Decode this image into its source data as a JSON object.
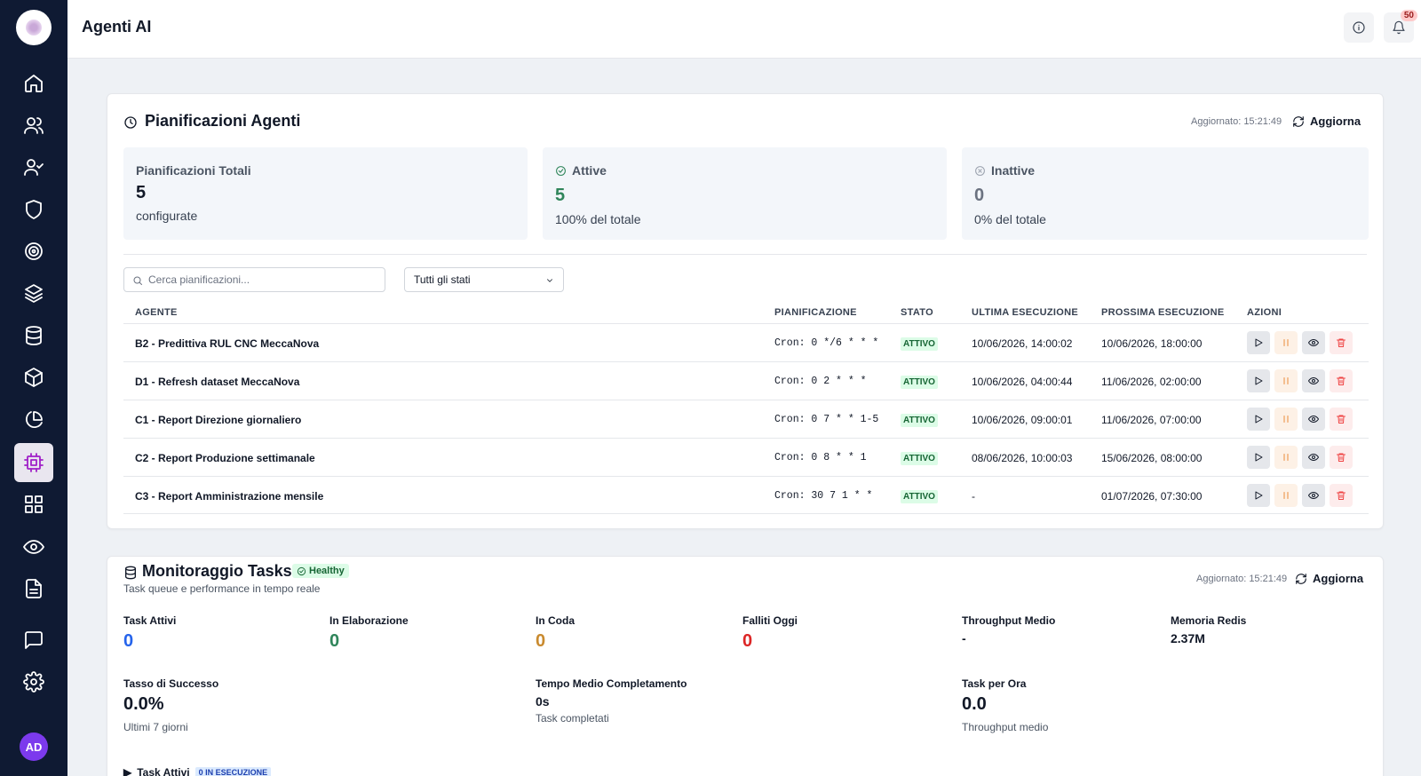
{
  "header": {
    "title": "Agenti AI",
    "notifications_count": "50"
  },
  "sidebar": {
    "avatar_initials": "AD",
    "items": [
      {
        "icon": "home-icon"
      },
      {
        "icon": "users-icon"
      },
      {
        "icon": "user-check-icon"
      },
      {
        "icon": "shield-icon"
      },
      {
        "icon": "target-icon"
      },
      {
        "icon": "layers-icon"
      },
      {
        "icon": "database-icon"
      },
      {
        "icon": "box-icon"
      },
      {
        "icon": "pie-chart-icon"
      },
      {
        "icon": "cpu-icon",
        "active": true
      },
      {
        "icon": "grid-icon"
      },
      {
        "icon": "eye-icon"
      },
      {
        "icon": "file-text-icon"
      },
      {
        "icon": "message-icon"
      },
      {
        "icon": "settings-icon"
      }
    ]
  },
  "schedules": {
    "title": "Pianificazioni Agenti",
    "updated": "Aggiornato: 15:21:49",
    "refresh_label": "Aggiorna",
    "stats": {
      "total": {
        "label": "Pianificazioni Totali",
        "value": "5",
        "sub": "configurate"
      },
      "active": {
        "label": "Attive",
        "value": "5",
        "sub": "100% del totale"
      },
      "inactive": {
        "label": "Inattive",
        "value": "0",
        "sub": "0% del totale"
      }
    },
    "search_placeholder": "Cerca pianificazioni...",
    "filter_selected": "Tutti gli stati",
    "columns": {
      "agent": "AGENTE",
      "schedule": "PIANIFICAZIONE",
      "status": "STATO",
      "last_run": "ULTIMA ESECUZIONE",
      "next_run": "PROSSIMA ESECUZIONE",
      "actions": "AZIONI"
    },
    "rows": [
      {
        "agent": "B2 - Predittiva RUL CNC MeccaNova",
        "schedule": "Cron: 0 */6 * * *",
        "status": "ATTIVO",
        "last_run": "10/06/2026, 14:00:02",
        "next_run": "10/06/2026, 18:00:00"
      },
      {
        "agent": "D1 - Refresh dataset MeccaNova",
        "schedule": "Cron: 0 2 * * *",
        "status": "ATTIVO",
        "last_run": "10/06/2026, 04:00:44",
        "next_run": "11/06/2026, 02:00:00"
      },
      {
        "agent": "C1 - Report Direzione giornaliero",
        "schedule": "Cron: 0 7 * * 1-5",
        "status": "ATTIVO",
        "last_run": "10/06/2026, 09:00:01",
        "next_run": "11/06/2026, 07:00:00"
      },
      {
        "agent": "C2 - Report Produzione settimanale",
        "schedule": "Cron: 0 8 * * 1",
        "status": "ATTIVO",
        "last_run": "08/06/2026, 10:00:03",
        "next_run": "15/06/2026, 08:00:00"
      },
      {
        "agent": "C3 - Report Amministrazione mensile",
        "schedule": "Cron: 30 7 1 * *",
        "status": "ATTIVO",
        "last_run": "-",
        "next_run": "01/07/2026, 07:30:00"
      }
    ]
  },
  "monitoring": {
    "title": "Monitoraggio Tasks",
    "health_badge": "Healthy",
    "subtitle": "Task queue e performance in tempo reale",
    "updated": "Aggiornato: 15:21:49",
    "refresh_label": "Aggiorna",
    "metrics": {
      "active": {
        "label": "Task Attivi",
        "value": "0"
      },
      "processing": {
        "label": "In Elaborazione",
        "value": "0"
      },
      "queued": {
        "label": "In Coda",
        "value": "0"
      },
      "failed": {
        "label": "Falliti Oggi",
        "value": "0"
      },
      "throughput": {
        "label": "Throughput Medio",
        "value": "-"
      },
      "redis": {
        "label": "Memoria Redis",
        "value": "2.37M"
      },
      "success": {
        "label": "Tasso di Successo",
        "value": "0.0%",
        "sub": "Ultimi 7 giorni"
      },
      "avg_time": {
        "label": "Tempo Medio Completamento",
        "value": "0s",
        "sub": "Task completati"
      },
      "per_hour": {
        "label": "Task per Ora",
        "value": "0.0",
        "sub": "Throughput medio"
      }
    },
    "active_tasks": {
      "label": "Task Attivi",
      "tag": "0 IN ESECUZIONE"
    }
  },
  "colors": {
    "sidebar_bg": "#0f1a33",
    "accent": "#a020c8",
    "blue_value": "#2563eb",
    "green_value": "#2f855a",
    "amber_value": "#c98a2e",
    "red_value": "#dc2626"
  }
}
